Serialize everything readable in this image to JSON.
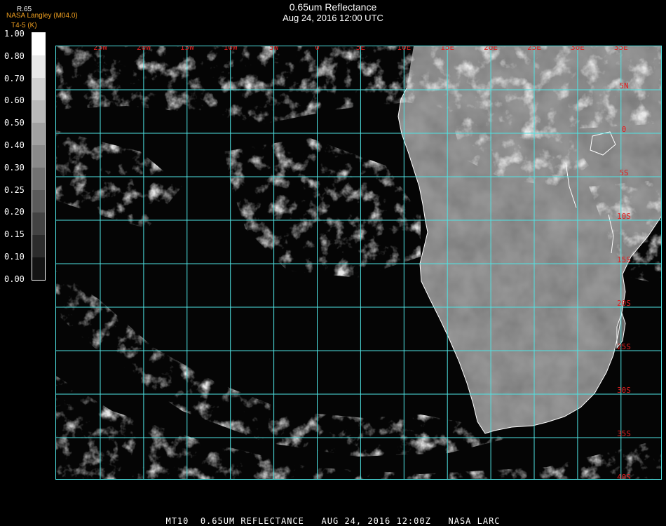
{
  "header": {
    "title": "0.65um Reflectance",
    "subtitle": "Aug 24, 2016 12:00 UTC",
    "producer": "NASA Langley (M04.0)",
    "product": "T4-5 (K)"
  },
  "colorbar": {
    "units_label": "R.65",
    "ticks": [
      "1.00",
      "0.80",
      "0.70",
      "0.60",
      "0.50",
      "0.40",
      "0.30",
      "0.25",
      "0.20",
      "0.15",
      "0.10",
      "0.00"
    ]
  },
  "map": {
    "longitude_labels": [
      "25W",
      "20W",
      "15W",
      "10W",
      "5W",
      "0",
      "5E",
      "10E",
      "15E",
      "20E",
      "25E",
      "30E",
      "35E"
    ],
    "latitude_labels": [
      "5N",
      "0",
      "5S",
      "10S",
      "15S",
      "20S",
      "25S",
      "30S",
      "35S",
      "40S"
    ],
    "colors": {
      "grid": "#4fe4e4",
      "label": "#e02020",
      "coast": "#ffffff",
      "ocean": "#050505",
      "land": "#6a6a6a",
      "cloud": "#e8e8e8"
    }
  },
  "footer": {
    "text": "MT10  0.65UM REFLECTANCE   AUG 24, 2016 12:00Z   NASA LARC"
  }
}
